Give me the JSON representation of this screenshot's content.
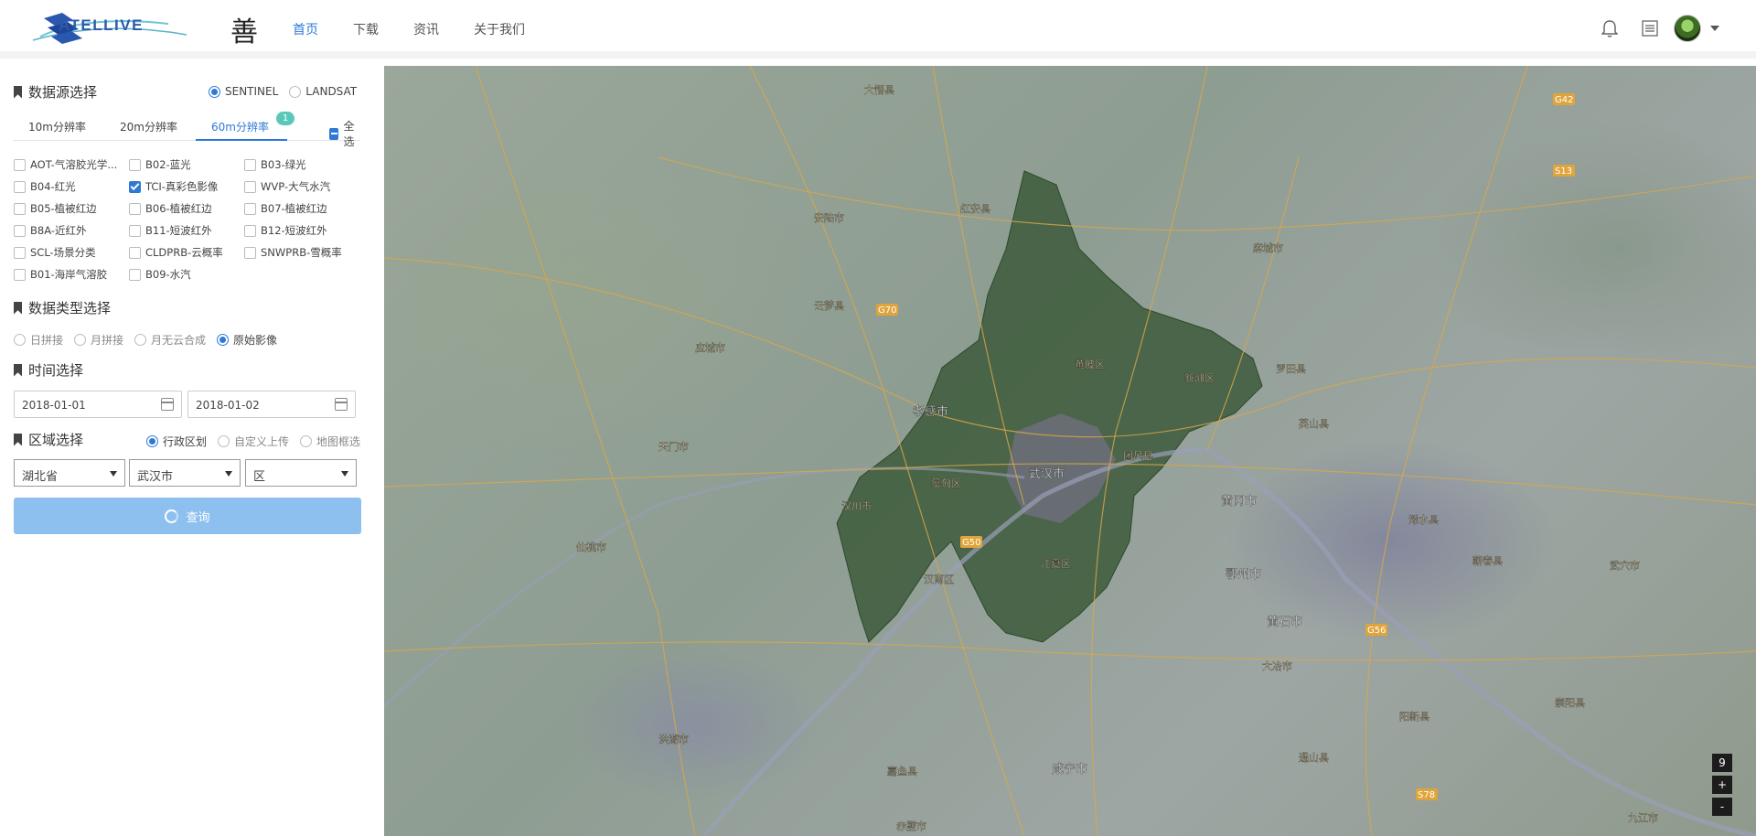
{
  "header": {
    "logo_text": "ATELLIVE",
    "brand_char": "善",
    "nav": [
      "首页",
      "下载",
      "资讯",
      "关于我们"
    ]
  },
  "datasource": {
    "title": "数据源选择",
    "options": [
      "SENTINEL",
      "LANDSAT"
    ],
    "selected": "SENTINEL"
  },
  "resolution_tabs": {
    "tabs": [
      "10m分辨率",
      "20m分辨率",
      "60m分辨率"
    ],
    "active": "60m分辨率",
    "badge": "1",
    "select_all": "全选"
  },
  "bands": [
    {
      "label": "AOT-气溶胶光学...",
      "checked": false
    },
    {
      "label": "B02-蓝光",
      "checked": false
    },
    {
      "label": "B03-绿光",
      "checked": false
    },
    {
      "label": "B04-红光",
      "checked": false
    },
    {
      "label": "TCI-真彩色影像",
      "checked": true
    },
    {
      "label": "WVP-大气水汽",
      "checked": false
    },
    {
      "label": "B05-植被红边",
      "checked": false
    },
    {
      "label": "B06-植被红边",
      "checked": false
    },
    {
      "label": "B07-植被红边",
      "checked": false
    },
    {
      "label": "B8A-近红外",
      "checked": false
    },
    {
      "label": "B11-短波红外",
      "checked": false
    },
    {
      "label": "B12-短波红外",
      "checked": false
    },
    {
      "label": "SCL-场景分类",
      "checked": false
    },
    {
      "label": "CLDPRB-云概率",
      "checked": false
    },
    {
      "label": "SNWPRB-雪概率",
      "checked": false
    },
    {
      "label": "B01-海岸气溶胶",
      "checked": false
    },
    {
      "label": "B09-水汽",
      "checked": false
    }
  ],
  "datatype": {
    "title": "数据类型选择",
    "options": [
      "日拼接",
      "月拼接",
      "月无云合成",
      "原始影像"
    ],
    "selected": "原始影像"
  },
  "time": {
    "title": "时间选择",
    "start": "2018-01-01",
    "end": "2018-01-02"
  },
  "region": {
    "title": "区域选择",
    "options": [
      "行政区划",
      "自定义上传",
      "地图框选"
    ],
    "selected": "行政区划",
    "province": "湖北省",
    "city": "武汉市",
    "district": "区"
  },
  "query_label": "查询",
  "map": {
    "zoom_level": "9",
    "zoom_in": "+",
    "zoom_out": "-",
    "labels": [
      "孝感市",
      "武汉市",
      "黄冈市",
      "鄂州市",
      "黄石市",
      "咸宁市",
      "汉川市",
      "黄陂区",
      "新洲区",
      "蔡甸区",
      "江夏区",
      "汉南区",
      "九江市",
      "天门市",
      "应城市",
      "云梦县",
      "安陆市",
      "大悟县",
      "麻城市",
      "红安县",
      "浠水县",
      "大冶市",
      "阳新县",
      "嘉鱼县",
      "赤壁市",
      "仙桃市",
      "洪湖市",
      "团风县",
      "罗田县",
      "英山县",
      "蕲春县",
      "武穴市",
      "通山县",
      "崇阳县"
    ],
    "road_labels": [
      "G70",
      "G42",
      "S13",
      "G50",
      "G56",
      "S78"
    ]
  }
}
